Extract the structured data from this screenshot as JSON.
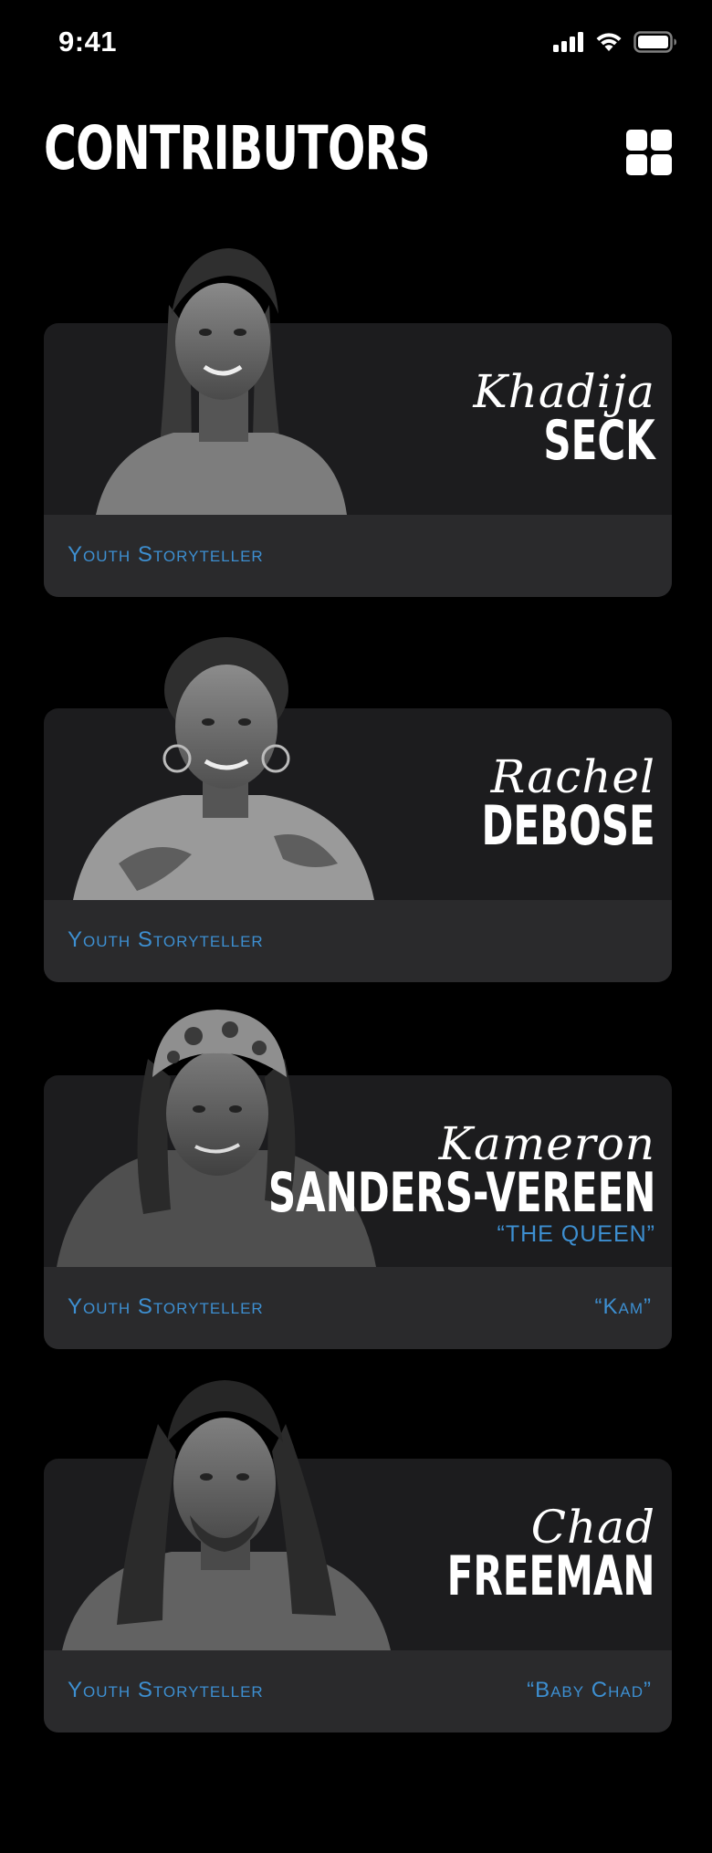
{
  "status_bar": {
    "time": "9:41"
  },
  "header": {
    "title": "CONTRIBUTORS"
  },
  "contributors": [
    {
      "first_name": "Khadija",
      "last_name": "SECK",
      "role": "Youth Storyteller"
    },
    {
      "first_name": "Rachel",
      "last_name": "DEBOSE",
      "role": "Youth Storyteller"
    },
    {
      "first_name": "Kameron",
      "last_name": "SANDERS-VEREEN",
      "title": "“THE QUEEN”",
      "role": "Youth Storyteller",
      "nickname": "“Kam”"
    },
    {
      "first_name": "Chad",
      "last_name": "FREEMAN",
      "role": "Youth Storyteller",
      "nickname": "“Baby Chad”"
    }
  ],
  "colors": {
    "background": "#000000",
    "card": "#1c1c1e",
    "card_footer": "#2a2a2c",
    "accent": "#3d8fd1"
  },
  "icons": {
    "grid": "grid-view-icon",
    "signal": "cellular-signal-icon",
    "wifi": "wifi-icon",
    "battery": "battery-icon"
  }
}
